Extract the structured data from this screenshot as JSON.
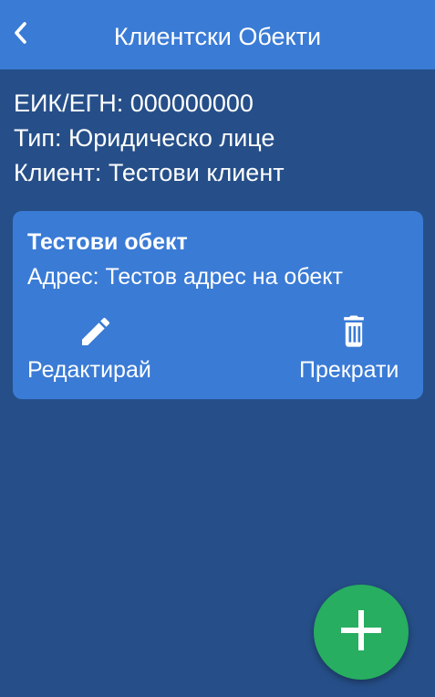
{
  "app_bar": {
    "title": "Клиентски Обекти",
    "back_icon": "chevron-left-icon"
  },
  "client_info": {
    "eik_line": "ЕИК/ЕГН: 000000000",
    "type_line": "Тип: Юридическо лице",
    "client_line": "Клиент: Тестови клиент"
  },
  "objects": [
    {
      "name": "Тестови обект",
      "address": "Адрес: Тестов адрес на обект",
      "actions": {
        "edit_label": "Редактирай",
        "edit_icon": "pencil-icon",
        "stop_label": "Прекрати",
        "stop_icon": "trash-icon"
      }
    }
  ],
  "fab": {
    "icon": "plus-icon"
  },
  "colors": {
    "background": "#264f89",
    "app_bar": "#3a7bd5",
    "card": "#3a7bd5",
    "fab": "#27ae60",
    "text": "#ffffff"
  }
}
